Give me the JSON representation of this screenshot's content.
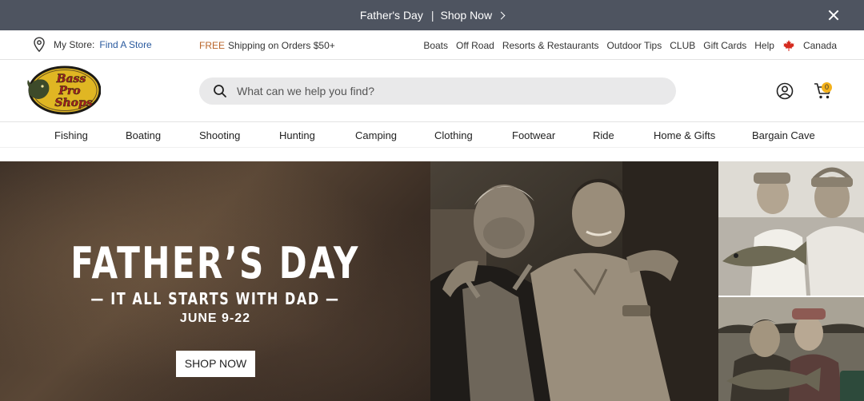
{
  "promo": {
    "text": "Father's Day",
    "separator": "|",
    "link": "Shop Now",
    "close_icon": "close-icon"
  },
  "utility": {
    "store_label": "My Store:",
    "store_link": "Find A Store",
    "shipping_free": "FREE",
    "shipping_text": "Shipping on Orders $50+",
    "links": [
      "Boats",
      "Off Road",
      "Resorts & Restaurants",
      "Outdoor Tips",
      "CLUB",
      "Gift Cards",
      "Help"
    ],
    "country": "Canada"
  },
  "header": {
    "logo_text": [
      "Bass",
      "Pro",
      "Shops"
    ],
    "search_placeholder": "What can we help you find?",
    "cart_count": "0"
  },
  "nav": {
    "items": [
      "Fishing",
      "Boating",
      "Shooting",
      "Hunting",
      "Camping",
      "Clothing",
      "Footwear",
      "Ride",
      "Home & Gifts",
      "Bargain Cave"
    ]
  },
  "hero": {
    "title": "FATHER’S DAY",
    "subtitle": "— IT ALL STARTS WITH DAD —",
    "dates": "JUNE 9-22",
    "button": "SHOP NOW"
  },
  "colors": {
    "promo_bg": "#4e5460",
    "link_blue": "#2a5a9e",
    "free_orange": "#b9652a",
    "cart_badge": "#f4b21c",
    "maple_red": "#d52b1e"
  }
}
